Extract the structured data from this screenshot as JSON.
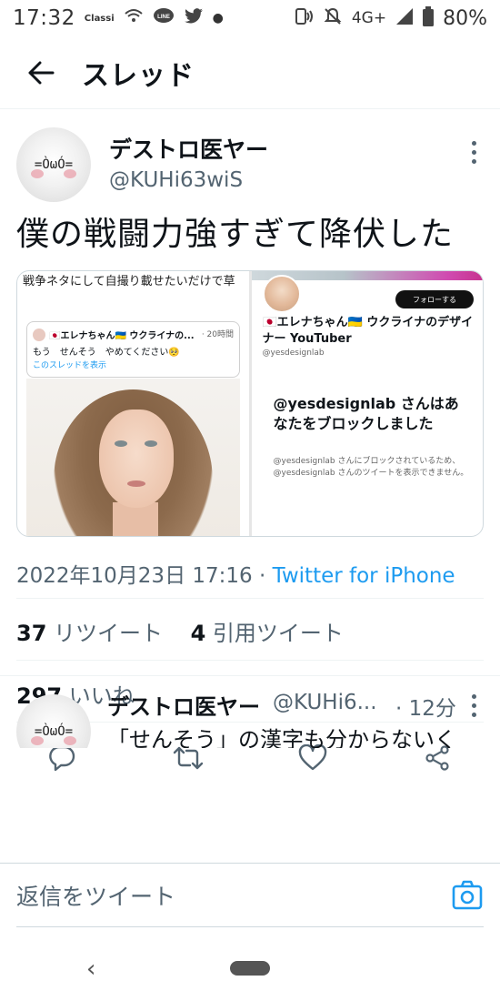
{
  "status_bar": {
    "time": "17:32",
    "apps": "Classi",
    "network": "4G+",
    "battery": "80%"
  },
  "header": {
    "title": "スレッド"
  },
  "tweet": {
    "display_name": "デストロ医ヤー",
    "handle": "@KUHi63wiS",
    "text": "僕の戦闘力強すぎて降伏した",
    "media": {
      "left": {
        "caption": "戦争ネタにして自撮り載せたいだけで草",
        "quoted": {
          "name": "🇯🇵エレナちゃん🇺🇦 ウクライナの...",
          "time": "· 20時間",
          "text": "もう　せんそう　やめてください🥺",
          "link": "このスレッドを表示"
        }
      },
      "right": {
        "follow": "フォローする",
        "profile_name": "🇯🇵エレナちゃん🇺🇦 ウクライナのデザイナー YouTuber",
        "profile_handle": "@yesdesignlab",
        "block_title": "@yesdesignlab さんはあなたをブロックしました",
        "block_desc": "@yesdesignlab さんにブロックされているため、@yesdesignlab さんのツイートを表示できません。"
      }
    },
    "date": "2022年10月23日 17:16",
    "separator": " · ",
    "source": "Twitter for iPhone",
    "retweets_count": "37",
    "retweets_label": "リツイート",
    "quotes_count": "4",
    "quotes_label": "引用ツイート",
    "likes_count": "297",
    "likes_label": "いいね"
  },
  "reply": {
    "display_name": "デストロ医ヤー",
    "handle": "@KUHi6...",
    "time": "· 12分",
    "text": "「せんそう」の漢字も分からないく"
  },
  "reply_bar": {
    "placeholder": "返信をツイート"
  },
  "colors": {
    "accent": "#1d9bf0",
    "text": "#0f1419",
    "muted": "#536471"
  }
}
